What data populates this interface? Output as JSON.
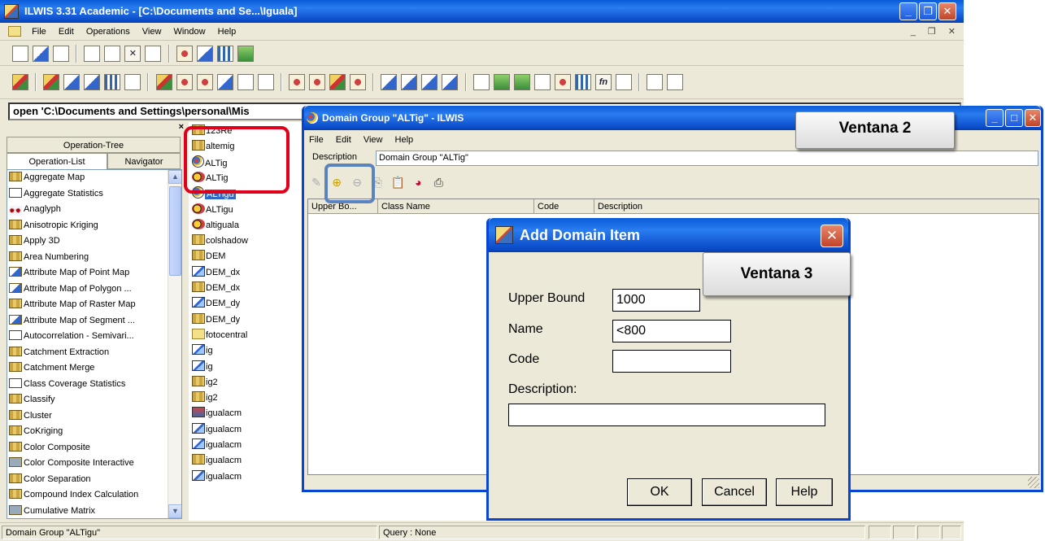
{
  "main": {
    "title": "ILWIS 3.31 Academic - [C:\\Documents and Se...\\Iguala]",
    "menu": [
      "File",
      "Edit",
      "Operations",
      "View",
      "Window",
      "Help"
    ],
    "command_line": "open 'C:\\Documents and Settings\\personal\\Mis"
  },
  "operations_pane": {
    "close": "×",
    "tab_tree": "Operation-Tree",
    "tab_list": "Operation-List",
    "tab_nav": "Navigator",
    "items": [
      "Aggregate Map",
      "Aggregate Statistics",
      "Anaglyph",
      "Anisotropic Kriging",
      "Apply 3D",
      "Area Numbering",
      "Attribute Map of Point Map",
      "Attribute Map of Polygon ...",
      "Attribute Map of Raster Map",
      "Attribute Map of Segment ...",
      "Autocorrelation - Semivari...",
      "Catchment Extraction",
      "Catchment Merge",
      "Class Coverage Statistics",
      "Classify",
      "Cluster",
      "CoKriging",
      "Color Composite",
      "Color Composite Interactive",
      "Color Separation",
      "Compound Index Calculation",
      "Cumulative Matrix"
    ]
  },
  "catalog": {
    "items": [
      {
        "name": "123Re",
        "icon": "table"
      },
      {
        "name": "altemig",
        "icon": "table"
      },
      {
        "name": "ALTig",
        "icon": "domain"
      },
      {
        "name": "ALTig",
        "icon": "domain-group"
      },
      {
        "name": "ALTigu",
        "icon": "domain",
        "selected": true
      },
      {
        "name": "ALTigu",
        "icon": "domain-group"
      },
      {
        "name": "altiguala",
        "icon": "representation"
      },
      {
        "name": "colshadow",
        "icon": "table"
      },
      {
        "name": "DEM",
        "icon": "table"
      },
      {
        "name": "DEM_dx",
        "icon": "map"
      },
      {
        "name": "DEM_dx",
        "icon": "table"
      },
      {
        "name": "DEM_dy",
        "icon": "map"
      },
      {
        "name": "DEM_dy",
        "icon": "table"
      },
      {
        "name": "fotocentral",
        "icon": "folder"
      },
      {
        "name": "ig",
        "icon": "map"
      },
      {
        "name": "ig",
        "icon": "segment-map"
      },
      {
        "name": "ig2",
        "icon": "table"
      },
      {
        "name": "ig2",
        "icon": "table"
      },
      {
        "name": "igualacm",
        "icon": "mixed"
      },
      {
        "name": "igualacm",
        "icon": "map"
      },
      {
        "name": "igualacm",
        "icon": "map"
      },
      {
        "name": "igualacm",
        "icon": "table"
      },
      {
        "name": "igualacm",
        "icon": "segment-map"
      }
    ]
  },
  "status": {
    "left": "Domain Group \"ALTigu\"",
    "query": "Query : None"
  },
  "window2": {
    "title": "Domain Group \"ALTig\" - ILWIS",
    "menu": [
      "File",
      "Edit",
      "View",
      "Help"
    ],
    "description_label": "Description",
    "description_value": "Domain Group \"ALTig\"",
    "columns": [
      "Upper Bo...",
      "Class Name",
      "Code",
      "Description"
    ],
    "callout": "Ventana 2"
  },
  "window3": {
    "title": "Add Domain Item",
    "callout": "Ventana 3",
    "upper_bound_label": "Upper Bound",
    "upper_bound_value": "1000",
    "name_label": "Name",
    "name_value": "<800",
    "code_label": "Code",
    "code_value": "",
    "description_label": "Description:",
    "description_value": "",
    "ok": "OK",
    "cancel": "Cancel",
    "help": "Help"
  },
  "icons": {
    "close": "close-icon",
    "minimize": "minimize-icon",
    "maximize": "maximize-icon"
  },
  "colors": {
    "titlebar": "#0a5bd8",
    "highlight_red": "#e0001b",
    "highlight_blue": "#5a84c0",
    "selection": "#316ac5"
  }
}
